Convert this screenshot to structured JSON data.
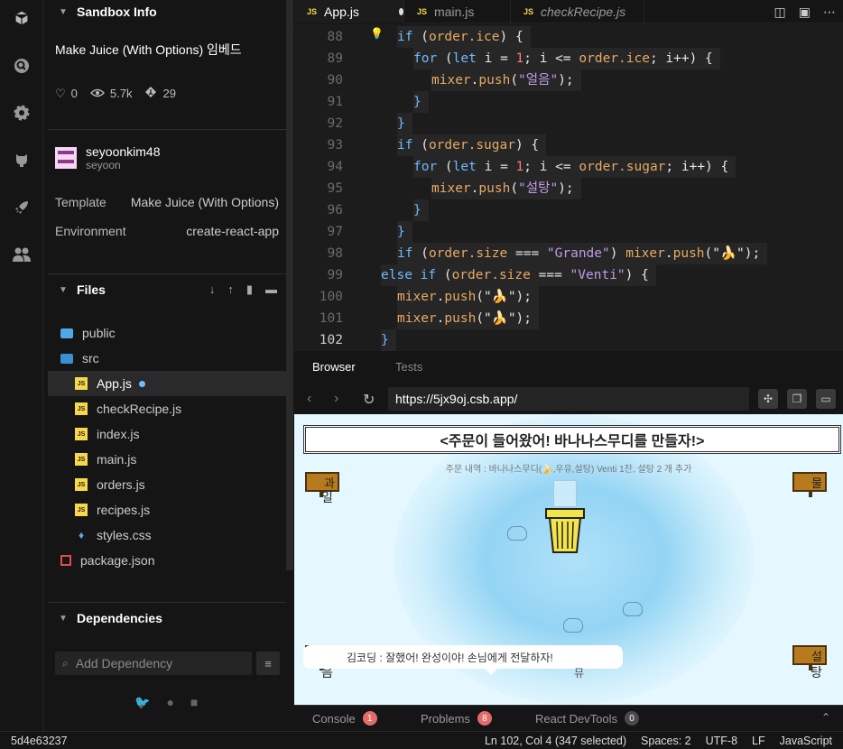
{
  "sidebar": {
    "sandbox_info_title": "Sandbox Info",
    "sandbox_name": "Make Juice (With Options) 임베드",
    "stats": {
      "likes": "0",
      "views": "5.7k",
      "forks": "29"
    },
    "author": {
      "name": "seyoonkim48",
      "handle": "seyoon"
    },
    "template_label": "Template",
    "template_value": "Make Juice (With Options)",
    "environment_label": "Environment",
    "environment_value": "create-react-app",
    "files_title": "Files",
    "files": [
      {
        "name": "public",
        "type": "folder"
      },
      {
        "name": "src",
        "type": "folder"
      },
      {
        "name": "App.js",
        "type": "js"
      },
      {
        "name": "checkRecipe.js",
        "type": "js"
      },
      {
        "name": "index.js",
        "type": "js"
      },
      {
        "name": "main.js",
        "type": "js"
      },
      {
        "name": "orders.js",
        "type": "js"
      },
      {
        "name": "recipes.js",
        "type": "js"
      },
      {
        "name": "styles.css",
        "type": "css"
      },
      {
        "name": "package.json",
        "type": "json"
      }
    ],
    "dependencies_title": "Dependencies",
    "add_dependency_placeholder": "Add Dependency"
  },
  "editor": {
    "tabs": [
      {
        "label": "App.js",
        "active": true,
        "modified": true
      },
      {
        "label": "main.js",
        "active": false
      },
      {
        "label": "checkRecipe.js",
        "active": false,
        "italic": true
      }
    ],
    "lines": [
      "88",
      "89",
      "90",
      "91",
      "92",
      "93",
      "94",
      "95",
      "96",
      "97",
      "98",
      "99",
      "100",
      "101",
      "102"
    ]
  },
  "preview": {
    "browser_tab": "Browser",
    "tests_tab": "Tests",
    "url": "https://5jx9oj.csb.app/",
    "banner": "<주문이 들어왔어! 바나나스무디를 만들자!>",
    "order_text": "주문 내역 : 바나나스무디(🍌,우유,설탕) Venti 1잔, 설탕 2 개 추가",
    "sign_top_left": "과일",
    "sign_top_right": "물",
    "sign_bottom_left": "얼음",
    "sign_bottom_right": "설탕",
    "sign_top_left_glyph": "과",
    "sign_top_right_glyph": "물",
    "sign_bottom_left_glyph": "얼",
    "sign_bottom_right_glyph": "설",
    "sign_bottom_center": "믹서",
    "dialogue": "김코딩 : 잘했어! 완성이야! 손님에게 전달하자!"
  },
  "console": {
    "console_label": "Console",
    "console_count": "1",
    "problems_label": "Problems",
    "problems_count": "8",
    "devtools_label": "React DevTools",
    "devtools_count": "0"
  },
  "status": {
    "commit": "5d4e63237",
    "position": "Ln 102, Col 4 (347 selected)",
    "spaces": "Spaces: 2",
    "encoding": "UTF-8",
    "eol": "LF",
    "language": "JavaScript"
  },
  "colors": {
    "keyword": "#6fb8ff",
    "variable": "#e8a964",
    "number": "#ff7a6e",
    "string": "#c39ae8",
    "badge_red": "#e56b6b",
    "badge_gray": "#4a4a4a"
  }
}
